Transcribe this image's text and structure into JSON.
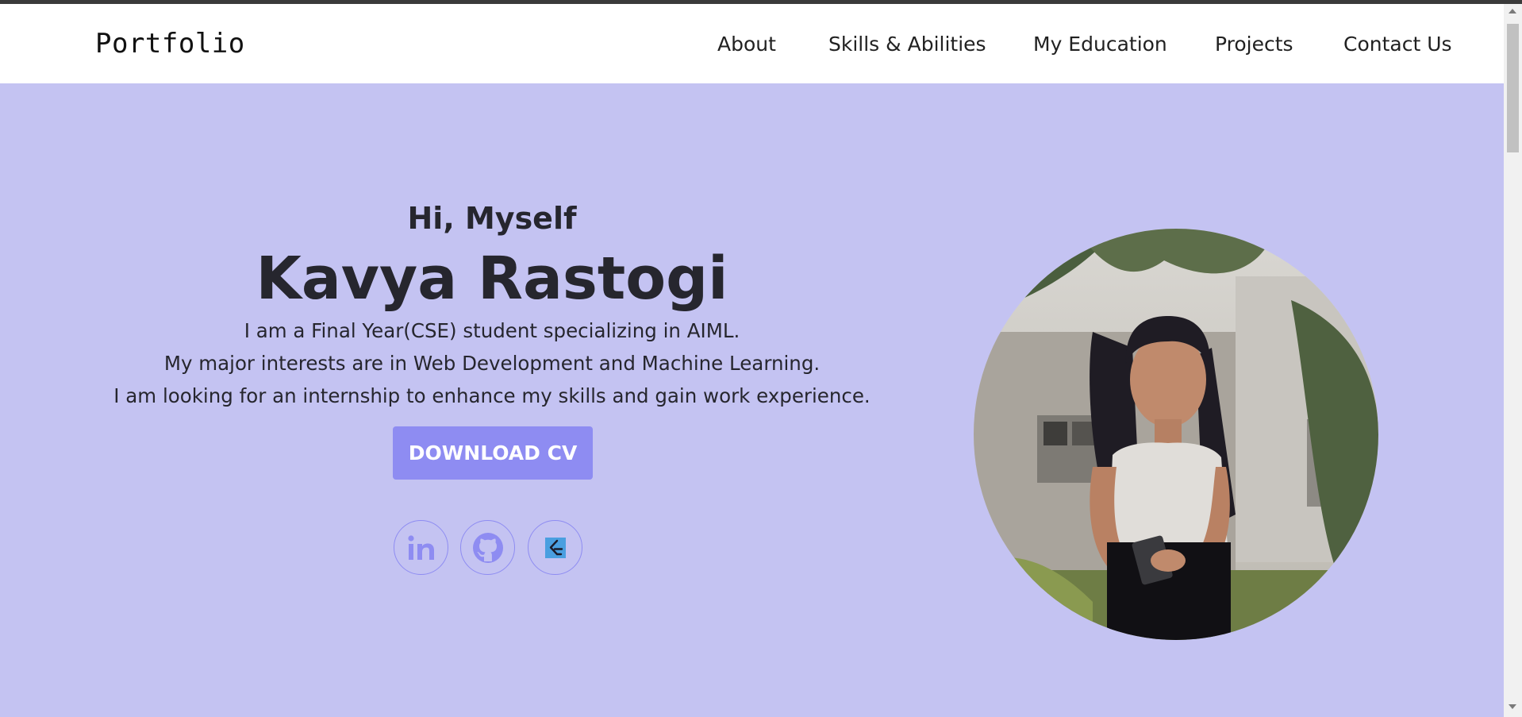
{
  "nav": {
    "brand": "Portfolio",
    "links": [
      "About",
      "Skills & Abilities",
      "My Education",
      "Projects",
      "Contact Us"
    ]
  },
  "hero": {
    "greeting": "Hi, Myself",
    "name": "Kavya Rastogi",
    "bio": [
      "I am a Final Year(CSE) student specializing in AIML.",
      "My major interests are in Web Development and Machine Learning.",
      "I am looking for an internship to enhance my skills and gain work experience."
    ],
    "cv_button": "DOWNLOAD CV",
    "socials": [
      {
        "icon": "linkedin-icon"
      },
      {
        "icon": "github-icon"
      },
      {
        "icon": "leetcode-icon"
      }
    ]
  },
  "colors": {
    "hero_bg": "#c4c3f2",
    "accent": "#8e8cf2",
    "text": "#26262e"
  }
}
